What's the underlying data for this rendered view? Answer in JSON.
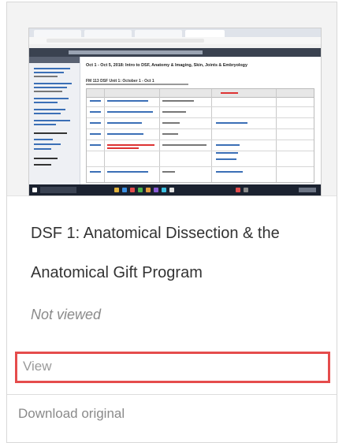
{
  "card": {
    "title": "DSF 1: Anatomical Dissection & the Anatomical Gift Program",
    "status": "Not viewed",
    "actions": {
      "view_label": "View",
      "download_label": "Download original"
    }
  },
  "thumbnail": {
    "page_heading": "Oct 1 - Oct 5, 2018: Intro to DSF, Anatomy & Imaging, Skin, Joints & Embryology",
    "table_title": "FM 113 DSF Unit 1: October 1 - Oct 1"
  },
  "colors": {
    "highlight_border": "#e54c4c",
    "title_text": "#333333",
    "muted_text": "#8a8a8a"
  }
}
